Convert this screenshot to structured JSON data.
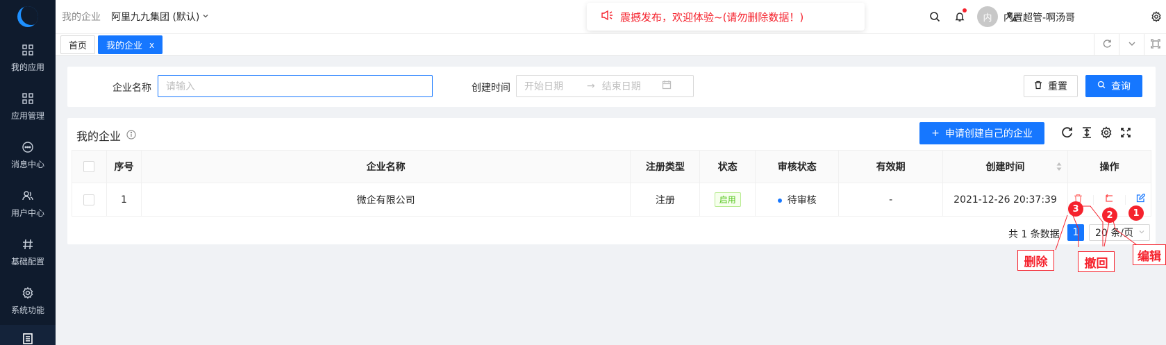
{
  "sidebar": {
    "items": [
      {
        "label": "我的应用",
        "icon": "grid-icon"
      },
      {
        "label": "应用管理",
        "icon": "app-grid-icon"
      },
      {
        "label": "消息中心",
        "icon": "message-icon"
      },
      {
        "label": "用户中心",
        "icon": "users-icon"
      },
      {
        "label": "基础配置",
        "icon": "hash-icon"
      },
      {
        "label": "系统功能",
        "icon": "gear-icon"
      }
    ]
  },
  "header": {
    "breadcrumb": "我的企业",
    "org": "阿里九九集团 (默认)",
    "notice": "震撼发布，欢迎体验~(请勿删除数据！)",
    "avatar_text": "内",
    "user_name": "内置超管-啊汤哥"
  },
  "tabs": [
    {
      "label": "首页"
    },
    {
      "label": "我的企业",
      "close": "x"
    }
  ],
  "search": {
    "name_label": "企业名称",
    "name_placeholder": "请输入",
    "time_label": "创建时间",
    "start_placeholder": "开始日期",
    "end_placeholder": "结束日期",
    "arrow": "→",
    "reset_label": "重置",
    "query_label": "查询"
  },
  "card": {
    "title": "我的企业",
    "create_label": "申请创建自己的企业",
    "create_prefix": "+"
  },
  "table": {
    "headers": [
      "序号",
      "企业名称",
      "注册类型",
      "状态",
      "审核状态",
      "有效期",
      "创建时间",
      "操作"
    ],
    "rows": [
      {
        "index": "1",
        "name": "微企有限公司",
        "reg_type": "注册",
        "status": "启用",
        "audit": "待审核",
        "validity": "-",
        "created": "2021-12-26 20:37:39"
      }
    ]
  },
  "pagination": {
    "total": "共 1 条数据",
    "current": "1",
    "page_size": "20 条/页"
  },
  "annotations": [
    {
      "num": "1",
      "label": "编辑"
    },
    {
      "num": "2",
      "label": "撤回"
    },
    {
      "num": "3",
      "label": "删除"
    }
  ],
  "colors": {
    "primary": "#1677ff",
    "sidebar": "#0f1b2d",
    "danger": "#f5222d",
    "success": "#52c41a"
  }
}
